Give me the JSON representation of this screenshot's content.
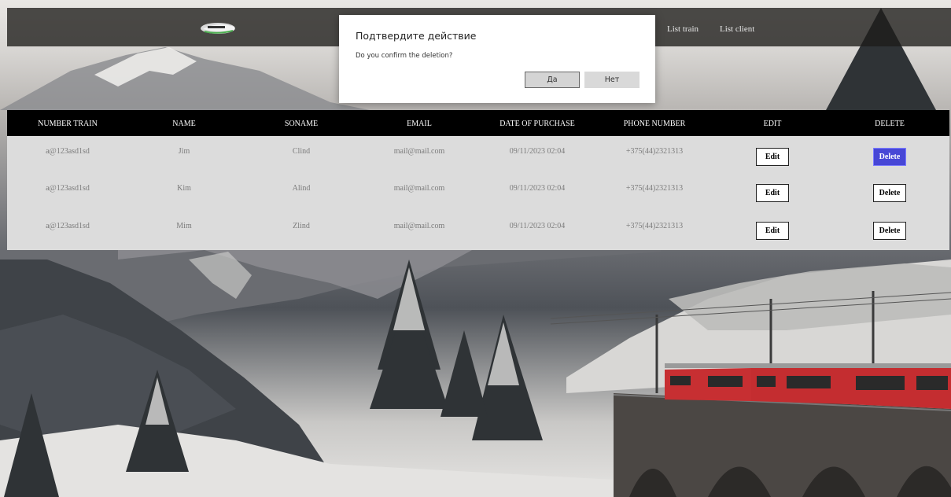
{
  "colors": {
    "header_bg": "#000000",
    "table_bg": "#dcdcdc",
    "delete_active": "#4747d6",
    "modal_button": "#d9d9d9"
  },
  "header": {
    "logo_icon": "train-icon",
    "nav": {
      "list_train": "List train",
      "list_client": "List client"
    }
  },
  "table": {
    "columns": [
      "NUMBER TRAIN",
      "NAME",
      "SONAME",
      "EMAIL",
      "DATE OF PURCHASE",
      "PHONE NUMBER",
      "EDIT",
      "DELETE"
    ],
    "rows": [
      {
        "number_train": "a@123asd1sd",
        "name": "Jim",
        "soname": "Clind",
        "email": "mail@mail.com",
        "date": "09/11/2023 02:04",
        "phone": "+375(44)2321313",
        "edit": "Edit",
        "delete": "Delete"
      },
      {
        "number_train": "a@123asd1sd",
        "name": "Kim",
        "soname": "Alind",
        "email": "mail@mail.com",
        "date": "09/11/2023 02:04",
        "phone": "+375(44)2321313",
        "edit": "Edit",
        "delete": "Delete"
      },
      {
        "number_train": "a@123asd1sd",
        "name": "Mim",
        "soname": "Zlind",
        "email": "mail@mail.com",
        "date": "09/11/2023 02:04",
        "phone": "+375(44)2321313",
        "edit": "Edit",
        "delete": "Delete"
      }
    ]
  },
  "dialog": {
    "title": "Подтвердите действие",
    "message": "Do you confirm the deletion?",
    "yes_label": "Да",
    "no_label": "Нет"
  }
}
